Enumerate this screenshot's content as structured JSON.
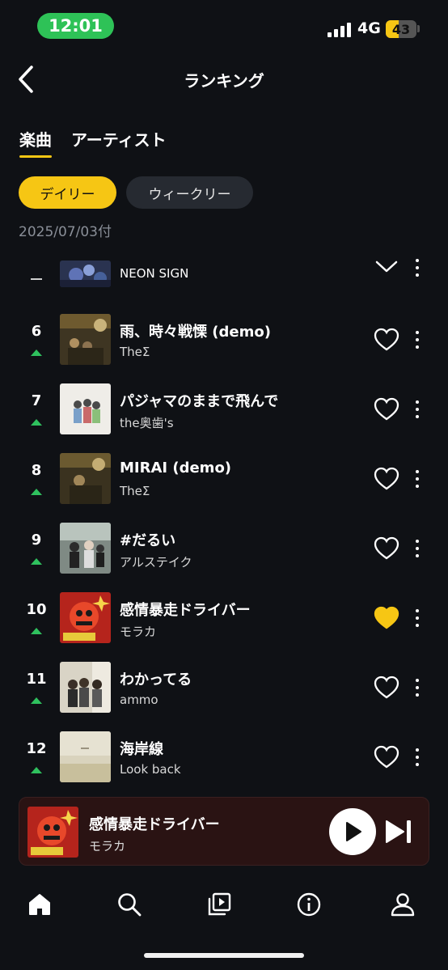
{
  "status_bar": {
    "time": "12:01",
    "network": "4G",
    "battery": "43",
    "battery_level": 0.43
  },
  "header": {
    "title": "ランキング"
  },
  "tabs": [
    {
      "label": "楽曲",
      "active": true
    },
    {
      "label": "アーティスト",
      "active": false
    }
  ],
  "filters": [
    {
      "label": "デイリー",
      "active": true
    },
    {
      "label": "ウィークリー",
      "active": false
    }
  ],
  "date": "2025/07/03付",
  "partial_row": {
    "rank": "–",
    "title": "NEON SIGN"
  },
  "rows": [
    {
      "rank": "6",
      "trend": "up",
      "title": "雨、時々戦慄 (demo)",
      "artist": "TheΣ",
      "liked": false
    },
    {
      "rank": "7",
      "trend": "up",
      "title": "パジャマのままで飛んで",
      "artist": "the奥歯's",
      "liked": false
    },
    {
      "rank": "8",
      "trend": "up",
      "title": "MIRAI (demo)",
      "artist": "TheΣ",
      "liked": false
    },
    {
      "rank": "9",
      "trend": "up",
      "title": "#だるい",
      "artist": "アルステイク",
      "liked": false
    },
    {
      "rank": "10",
      "trend": "up",
      "title": "感情暴走ドライバー",
      "artist": "モラカ",
      "liked": true
    },
    {
      "rank": "11",
      "trend": "up",
      "title": "わかってる",
      "artist": "ammo",
      "liked": false
    },
    {
      "rank": "12",
      "trend": "up",
      "title": "海岸線",
      "artist": "Look back",
      "liked": false
    }
  ],
  "mini_player": {
    "title": "感情暴走ドライバー",
    "artist": "モラカ"
  },
  "bottom_nav": [
    {
      "icon": "home-icon",
      "active": true
    },
    {
      "icon": "search-icon",
      "active": false
    },
    {
      "icon": "library-icon",
      "active": false
    },
    {
      "icon": "info-icon",
      "active": false
    },
    {
      "icon": "profile-icon",
      "active": false
    }
  ],
  "colors": {
    "accent": "#f6c614",
    "background": "#0f1115",
    "trend_up": "#2fc15e",
    "status_pill": "#2ec257"
  }
}
